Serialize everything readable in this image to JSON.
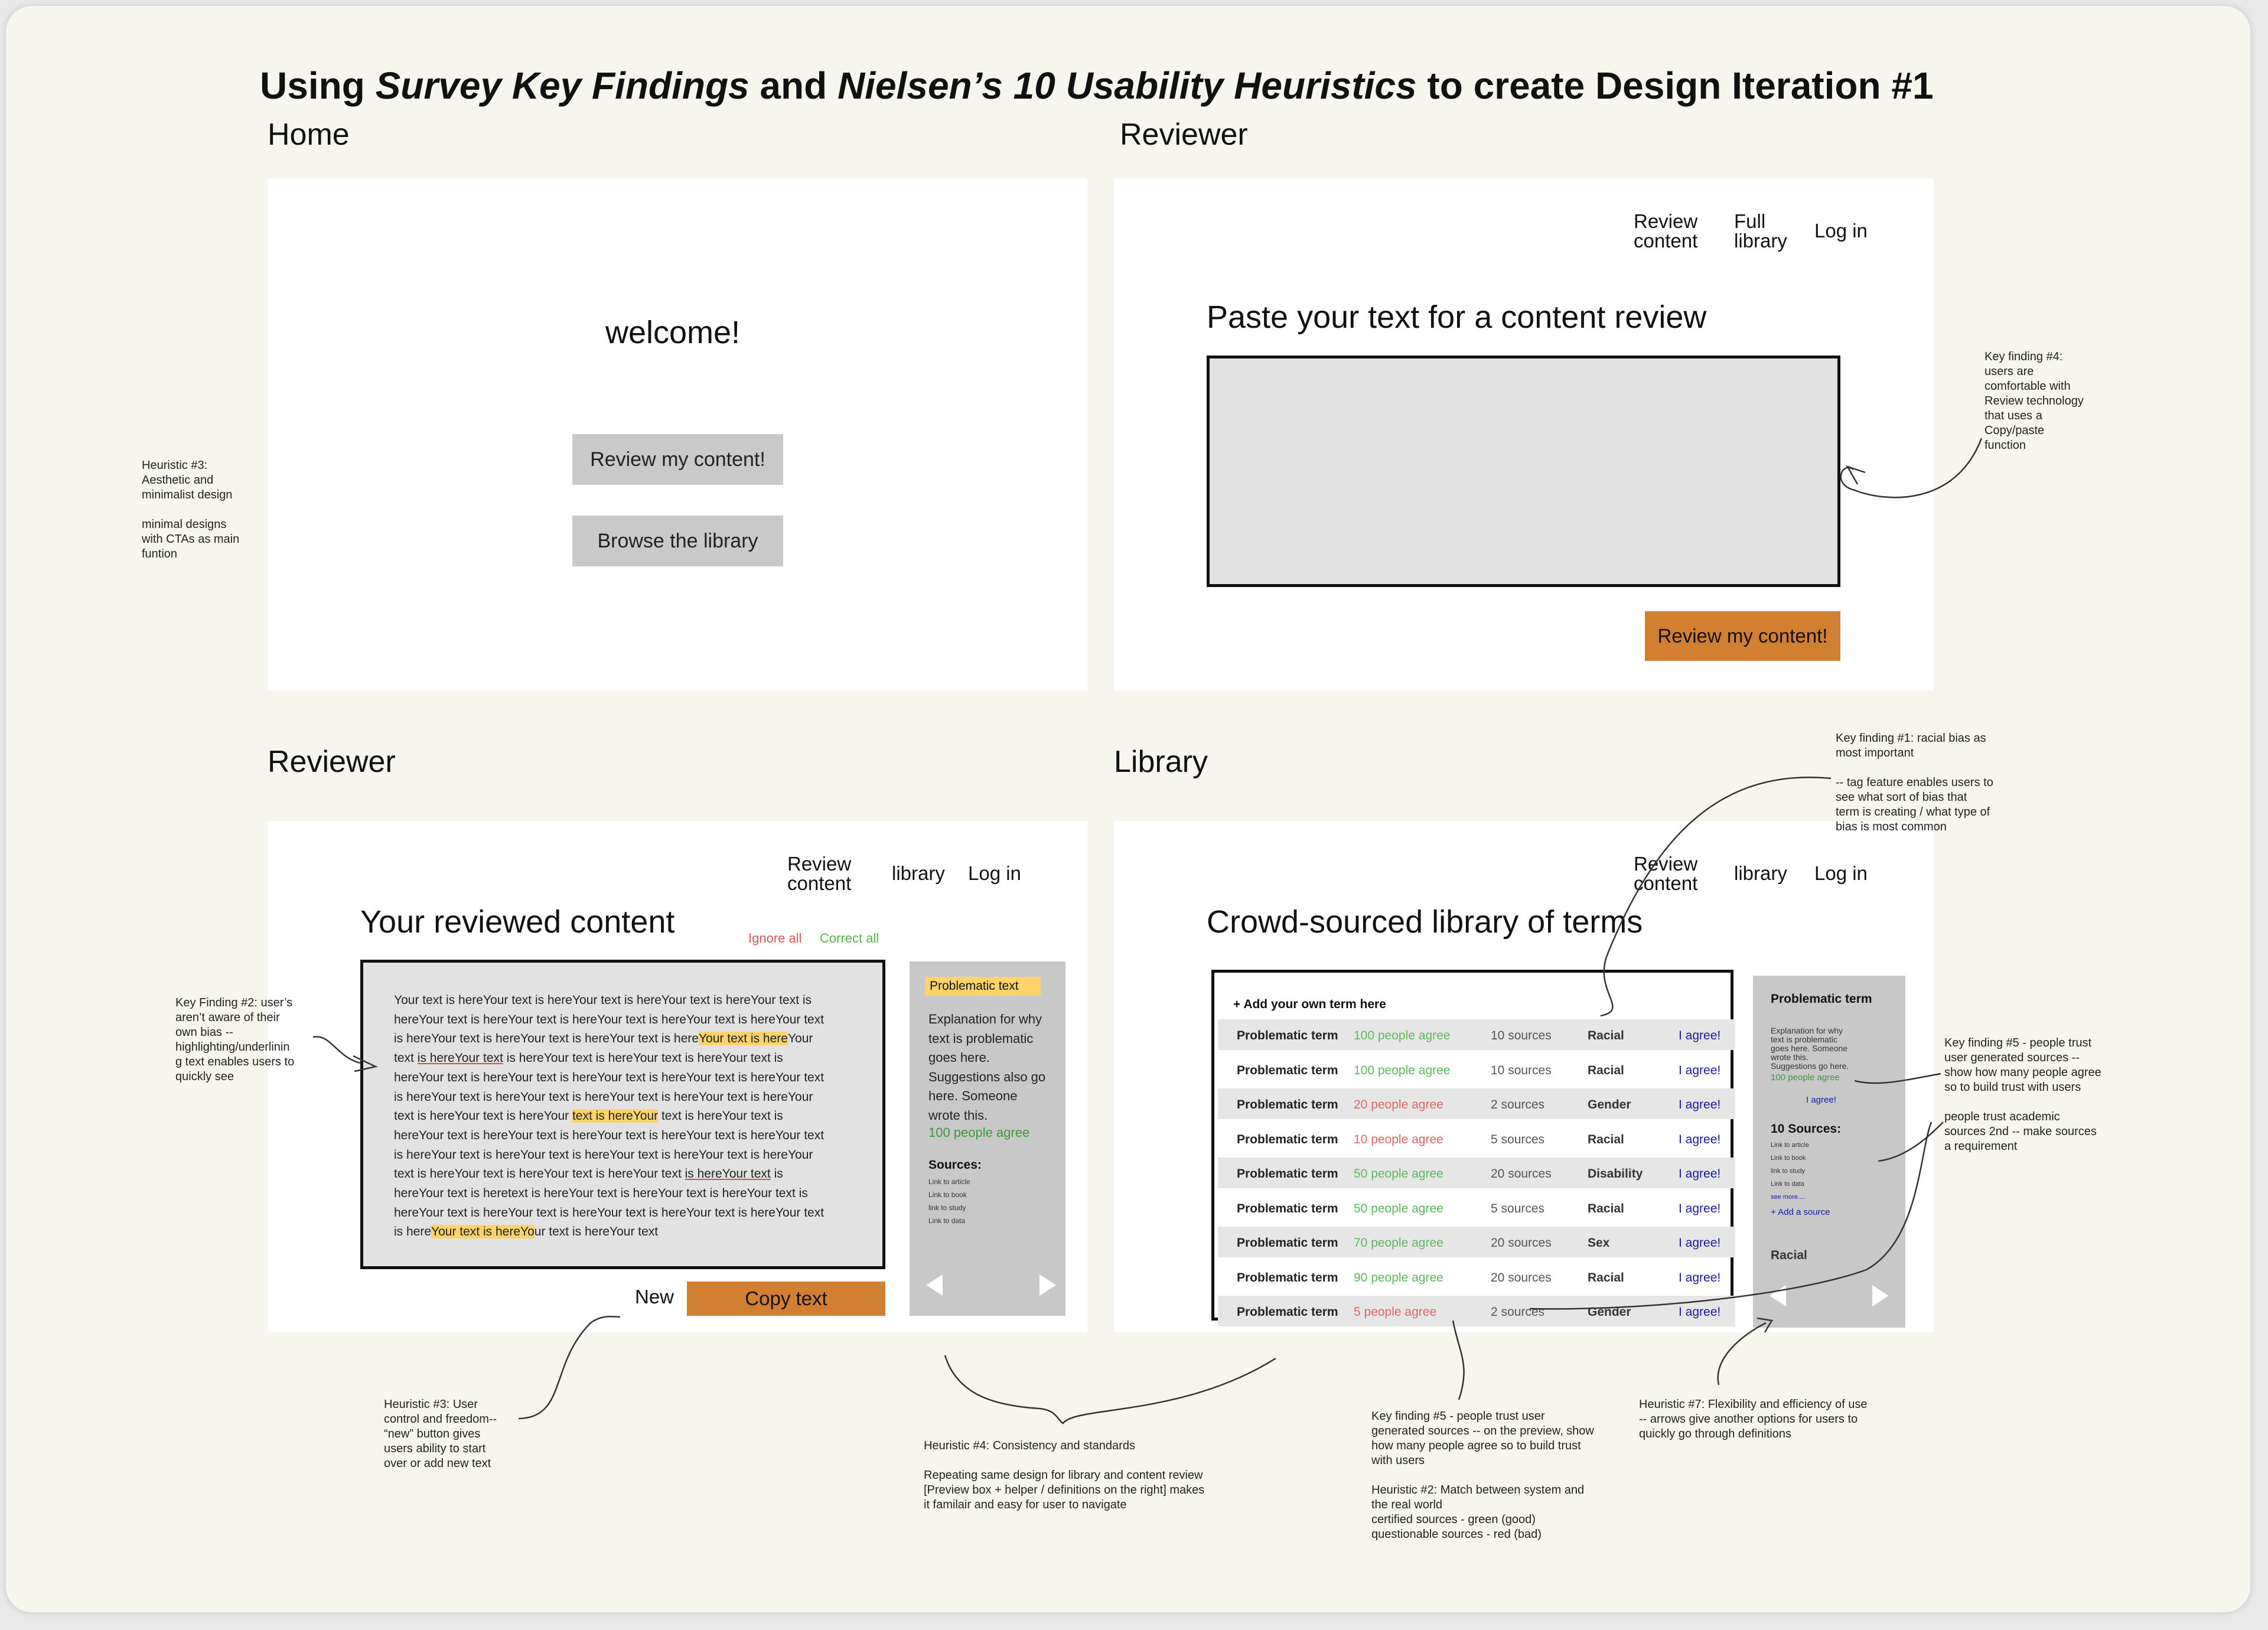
{
  "title": {
    "p1": "Using ",
    "p2": "Survey Key Findings",
    "p3": " and ",
    "p4": "Nielsen’s 10 Usability Heuristics",
    "p5": " to create Design Iteration #1"
  },
  "frames": {
    "home": {
      "label": "Home",
      "welcome": "welcome!",
      "review_button": "Review my content!",
      "library_button": "Browse the library"
    },
    "reviewer1": {
      "label": "Reviewer",
      "nav": [
        "Review content",
        "Full library",
        "Log in"
      ],
      "heading": "Paste your text for a content review",
      "review_button": "Review my content!"
    },
    "reviewer2": {
      "label": "Reviewer",
      "nav": [
        "Review content",
        "library",
        "Log in"
      ],
      "heading": "Your reviewed content",
      "ignore_all": "Ignore all",
      "correct_all": "Correct all",
      "text_lines": [
        "Your text is hereYour text is hereYour text is hereYour text is hereYour text is",
        "hereYour text is hereYour text is hereYour text is hereYour text is hereYour text",
        "is hereYour text is hereYour text is hereYour text is hereYour text is hereYour",
        "text is hereYour text is hereYour text is hereYour text is hereYour text is",
        "hereYour text is hereYour text is hereYour text is hereYour text is hereYour text",
        "is hereYour text is hereYour text is hereYour text is hereYour text is hereYour",
        "text is hereYour text is hereYour text is hereYour text is hereYour text is",
        "hereYour text is hereYour text is hereYour text is hereYour text is hereYour text",
        "is hereYour text is hereYour text is hereYour text is hereYour text is hereYour",
        "text is hereYour text is hereYour text is hereYour text is hereYour text is",
        "hereYour text is heretext is hereYour text is hereYour text is hereYour text is",
        "hereYour text is hereYour text is hereYour text is hereYour text is hereYour text",
        "is hereYour text is hereYour text is hereYour text"
      ],
      "new_button": "New",
      "copy_button": "Copy text",
      "side": {
        "tag": "Problematic text",
        "explanation": "Explanation for why text is problematic goes here. Suggestions also go here. Someone wrote this.",
        "agree": "100 people agree",
        "sources_title": "Sources:",
        "sources": [
          "Link to article",
          "Link to book",
          "link to study",
          "Link to data"
        ]
      }
    },
    "library": {
      "label": "Library",
      "nav": [
        "Review content",
        "library",
        "Log in"
      ],
      "heading": "Crowd-sourced library of terms",
      "add_term": "+ Add your own term here",
      "rows": [
        {
          "term": "Problematic term",
          "agree": "100 people agree",
          "sources": "10 sources",
          "tag": "Racial",
          "button": "I agree!",
          "status": "good"
        },
        {
          "term": "Problematic term",
          "agree": "100 people agree",
          "sources": "10 sources",
          "tag": "Racial",
          "button": "I agree!",
          "status": "good"
        },
        {
          "term": "Problematic term",
          "agree": "20 people agree",
          "sources": "2 sources",
          "tag": "Gender",
          "button": "I agree!",
          "status": "bad"
        },
        {
          "term": "Problematic term",
          "agree": "10 people agree",
          "sources": "5 sources",
          "tag": "Racial",
          "button": "I agree!",
          "status": "bad"
        },
        {
          "term": "Problematic term",
          "agree": "50 people agree",
          "sources": "20 sources",
          "tag": "Disability",
          "button": "I agree!",
          "status": "good"
        },
        {
          "term": "Problematic term",
          "agree": "50 people agree",
          "sources": "5 sources",
          "tag": "Racial",
          "button": "I agree!",
          "status": "good"
        },
        {
          "term": "Problematic term",
          "agree": "70 people agree",
          "sources": "20 sources",
          "tag": "Sex",
          "button": "I agree!",
          "status": "good"
        },
        {
          "term": "Problematic term",
          "agree": "90 people agree",
          "sources": "20 sources",
          "tag": "Racial",
          "button": "I agree!",
          "status": "good"
        },
        {
          "term": "Problematic term",
          "agree": "5 people agree",
          "sources": "2 sources",
          "tag": "Gender",
          "button": "I agree!",
          "status": "bad"
        }
      ],
      "side": {
        "title": "Problematic term",
        "explanation": "Explanation for why text is problematic goes here. Someone wrote this. Suggestions go here.",
        "agree": "100 people agree",
        "agree_button": "I agree!",
        "sources_title": "10 Sources:",
        "sources": [
          "Link to article",
          "Link to book",
          "link to study",
          "Link to data"
        ],
        "see_more": "see more....",
        "add_source": "+ Add a source",
        "tag": "Racial"
      }
    }
  },
  "notes": {
    "heuristic3_left": "Heuristic #3:\nAesthetic and\nminimalist design\n\nminimal designs\nwith CTAs as main\nfuntion",
    "keyfinding4": "Key finding #4:\nusers are\ncomfortable with\nReview technology\nthat uses a\nCopy/paste\nfunction",
    "keyfinding1": "Key finding #1: racial bias as\nmost important\n\n-- tag feature enables users to\nsee what sort of bias that\nterm is creating / what type of\nbias is most common",
    "keyfinding2": "Key Finding #2: user’s\naren’t aware of their\nown bias --\nhighlighting/underlinin\ng text enables users to\nquickly see",
    "keyfinding5_right": "Key finding #5 - people trust\nuser generated sources --\nshow how many people agree\nso to build trust with users\n\npeople trust academic\nsources 2nd -- make sources\na requirement",
    "heuristic3_bottom": "Heuristic #3: User\ncontrol and freedom--\n“new” button gives\nusers ability to start\nover or add new text",
    "heuristic4": "Heuristic #4: Consistency and standards\n\nRepeating same design for library and content review\n[Preview box + helper / definitions on the right]  makes\nit familair and easy for user to navigate",
    "keyfinding5_bottom": "Key finding #5 - people trust user\ngenerated sources -- on the preview, show\nhow many people agree so to build trust\nwith users\n\nHeuristic #2: Match between system and\nthe real world\ncertified sources - green (good)\nquestionable sources - red (bad)",
    "heuristic7": "Heuristic #7: Flexibility and efficiency of use\n-- arrows give another options for users to\nquickly go through definitions"
  }
}
